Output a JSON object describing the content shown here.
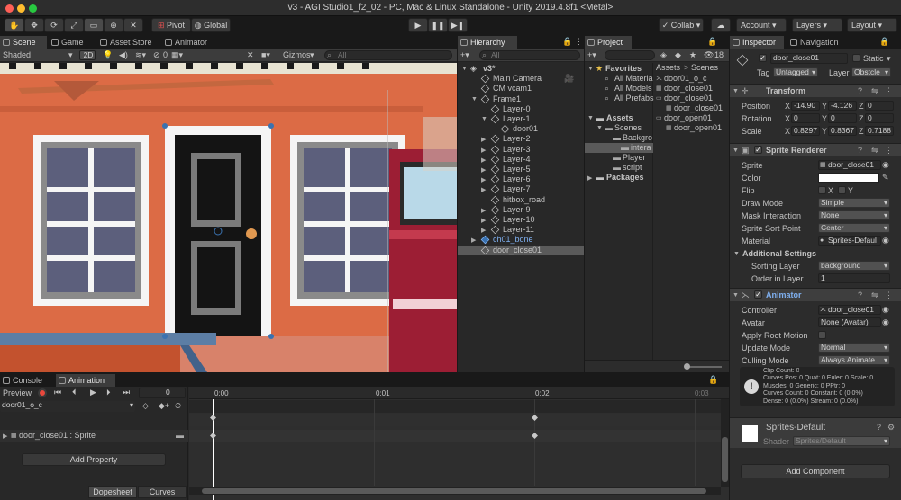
{
  "window": {
    "title": "v3 - AGI Studio1_f2_02 - PC, Mac & Linux Standalone - Unity 2019.4.8f1 <Metal>"
  },
  "toolbar": {
    "pivot": "Pivot",
    "global": "Global",
    "collab": "Collab",
    "account": "Account",
    "layers": "Layers",
    "layout": "Layout"
  },
  "scene": {
    "tabs": [
      "Scene",
      "Game",
      "Asset Store",
      "Animator"
    ],
    "shading": "Shaded",
    "mode2d": "2D",
    "hidden_count": "0",
    "gizmos": "Gizmos",
    "search_placeholder": "All"
  },
  "hierarchy": {
    "tab": "Hierarchy",
    "search_placeholder": "All",
    "items": [
      {
        "label": "v3*",
        "depth": 0,
        "fold": "open"
      },
      {
        "label": "Main Camera",
        "depth": 1,
        "fold": ""
      },
      {
        "label": "CM vcam1",
        "depth": 1,
        "fold": ""
      },
      {
        "label": "Frame1",
        "depth": 1,
        "fold": "open"
      },
      {
        "label": "Layer-0",
        "depth": 2,
        "fold": ""
      },
      {
        "label": "Layer-1",
        "depth": 2,
        "fold": "open"
      },
      {
        "label": "door01",
        "depth": 3,
        "fold": ""
      },
      {
        "label": "Layer-2",
        "depth": 2,
        "fold": "closed"
      },
      {
        "label": "Layer-3",
        "depth": 2,
        "fold": "closed"
      },
      {
        "label": "Layer-4",
        "depth": 2,
        "fold": "closed"
      },
      {
        "label": "Layer-5",
        "depth": 2,
        "fold": "closed"
      },
      {
        "label": "Layer-6",
        "depth": 2,
        "fold": "closed"
      },
      {
        "label": "Layer-7",
        "depth": 2,
        "fold": "closed"
      },
      {
        "label": "hitbox_road",
        "depth": 2,
        "fold": ""
      },
      {
        "label": "Layer-9",
        "depth": 2,
        "fold": "closed"
      },
      {
        "label": "Layer-10",
        "depth": 2,
        "fold": "closed"
      },
      {
        "label": "Layer-11",
        "depth": 2,
        "fold": "closed"
      },
      {
        "label": "ch01_bone",
        "depth": 1,
        "fold": "closed",
        "prefab": true
      },
      {
        "label": "door_close01",
        "depth": 1,
        "fold": "",
        "selected": true
      }
    ]
  },
  "project": {
    "tab": "Project",
    "count": "18",
    "favorites_header": "Favorites",
    "favorites": [
      "All Materia",
      "All Models",
      "All Prefabs"
    ],
    "assets_header": "Assets",
    "tree": [
      {
        "label": "Scenes",
        "depth": 1
      },
      {
        "label": "Backgro",
        "depth": 2
      },
      {
        "label": "intera",
        "depth": 3,
        "selected": true
      },
      {
        "label": "Player",
        "depth": 2
      },
      {
        "label": "script",
        "depth": 2
      }
    ],
    "packages": "Packages",
    "breadcrumb": [
      "Assets",
      "Scenes"
    ],
    "files": [
      "door01_o_c",
      "door_close01",
      "door_close01",
      "door_close01",
      "door_open01",
      "door_open01"
    ]
  },
  "inspector": {
    "tabs": [
      "Inspector",
      "Navigation"
    ],
    "object_name": "door_close01",
    "static_label": "Static",
    "tag_label": "Tag",
    "tag": "Untagged",
    "layer_label": "Layer",
    "layer": "Obstcle",
    "transform": {
      "title": "Transform",
      "position_label": "Position",
      "position": [
        "-14.90",
        "-4.126",
        "0"
      ],
      "rotation_label": "Rotation",
      "rotation": [
        "0",
        "0",
        "0"
      ],
      "scale_label": "Scale",
      "scale": [
        "0.8297",
        "0.8367",
        "0.7188"
      ]
    },
    "sprite_renderer": {
      "title": "Sprite Renderer",
      "sprite_label": "Sprite",
      "sprite": "door_close01",
      "color_label": "Color",
      "flip_label": "Flip",
      "flip_x": "X",
      "flip_y": "Y",
      "draw_mode_label": "Draw Mode",
      "draw_mode": "Simple",
      "mask_label": "Mask Interaction",
      "mask": "None",
      "sort_point_label": "Sprite Sort Point",
      "sort_point": "Center",
      "material_label": "Material",
      "material": "Sprites-Defaul",
      "additional": "Additional Settings",
      "sorting_layer_label": "Sorting Layer",
      "sorting_layer": "background",
      "order_label": "Order in Layer",
      "order": "1"
    },
    "animator": {
      "title": "Animator",
      "controller_label": "Controller",
      "controller": "door_close01",
      "avatar_label": "Avatar",
      "avatar": "None (Avatar)",
      "root_motion_label": "Apply Root Motion",
      "update_mode_label": "Update Mode",
      "update_mode": "Normal",
      "culling_label": "Culling Mode",
      "culling": "Always Animate",
      "info": [
        "Clip Count: 0",
        "Curves Pos: 0 Quat: 0 Euler: 0 Scale: 0",
        "Muscles: 0 Generic: 0 PPtr: 0",
        "Curves Count: 0 Constant: 0 (0.0%)",
        "Dense: 0 (0.0%) Stream: 0 (0.0%)"
      ]
    },
    "material": {
      "name": "Sprites-Default",
      "shader_label": "Shader",
      "shader": "Sprites/Default"
    },
    "add_component": "Add Component"
  },
  "animation": {
    "tabs": [
      "Console",
      "Animation"
    ],
    "preview": "Preview",
    "frame": "0",
    "clip": "door01_o_c",
    "property": "door_close01 : Sprite",
    "add_property": "Add Property",
    "dopesheet": "Dopesheet",
    "curves": "Curves",
    "ticks": [
      "0:00",
      "0:01",
      "0:02",
      "0:03"
    ]
  },
  "colors": {
    "accent": "#3a72b0",
    "prefab": "#7fb0f0",
    "wall": "#dc6b45",
    "record": "#e8483c"
  }
}
